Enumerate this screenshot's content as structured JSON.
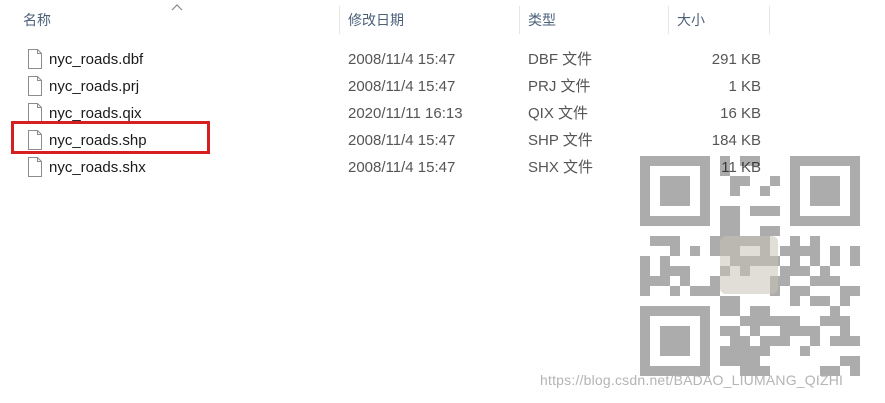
{
  "columns": {
    "name": "名称",
    "modified": "修改日期",
    "type": "类型",
    "size": "大小"
  },
  "sort_indicator": "chevron-up-icon",
  "files": [
    {
      "name": "nyc_roads.dbf",
      "modified": "2008/11/4 15:47",
      "type": "DBF 文件",
      "size": "291 KB"
    },
    {
      "name": "nyc_roads.prj",
      "modified": "2008/11/4 15:47",
      "type": "PRJ 文件",
      "size": "1 KB"
    },
    {
      "name": "nyc_roads.qix",
      "modified": "2020/11/11 16:13",
      "type": "QIX 文件",
      "size": "16 KB"
    },
    {
      "name": "nyc_roads.shp",
      "modified": "2008/11/4 15:47",
      "type": "SHP 文件",
      "size": "184 KB"
    },
    {
      "name": "nyc_roads.shx",
      "modified": "2008/11/4 15:47",
      "type": "SHX 文件",
      "size": "11 KB"
    }
  ],
  "highlighted_file": "nyc_roads.shp",
  "highlight_color": "#d42020",
  "watermark": "https://blog.csdn.net/BADAO_LIUMANG_QIZHI"
}
